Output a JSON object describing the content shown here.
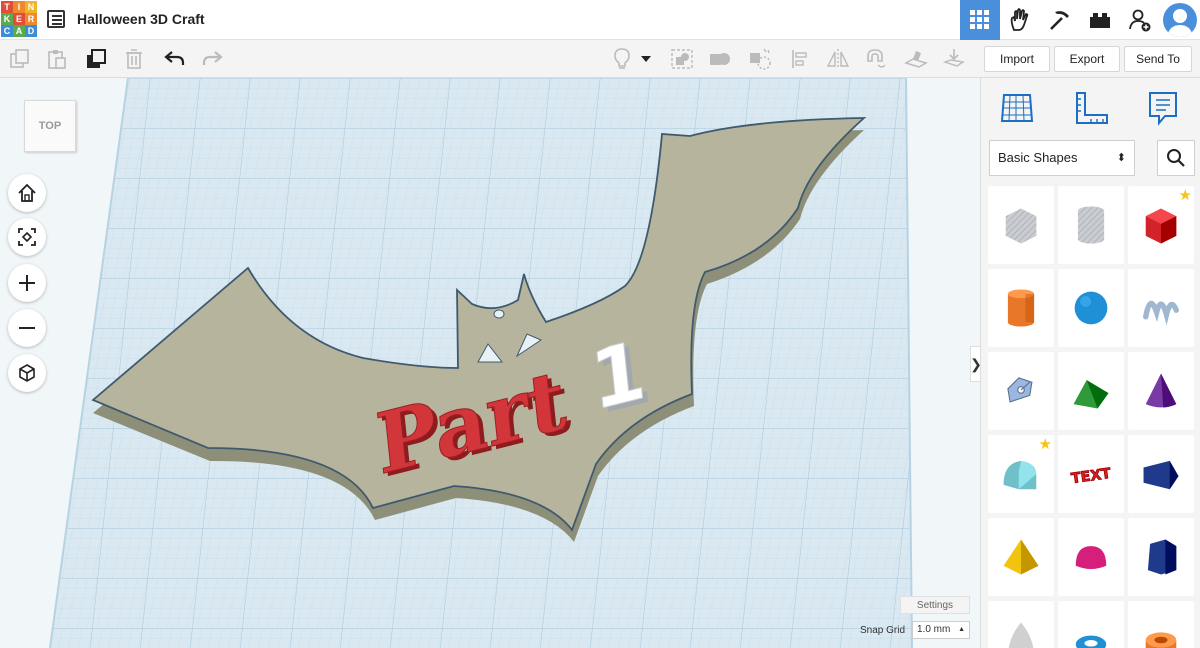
{
  "app": {
    "logo_letters": [
      "T",
      "I",
      "N",
      "K",
      "E",
      "R",
      "C",
      "A",
      "D"
    ],
    "logo_colors": [
      "#e04d39",
      "#ef8a2c",
      "#f0b429",
      "#5cab4b",
      "#e04d39",
      "#ef8a2c",
      "#3b8dd6",
      "#5cab4b",
      "#3b8dd6"
    ],
    "document_title": "Halloween 3D Craft",
    "accent_color": "#4a8fdb"
  },
  "topbar": {
    "buttons": [
      {
        "name": "3d-design-view",
        "icon": "grid-icon",
        "active": true
      },
      {
        "name": "blocks-view",
        "icon": "hand-icon",
        "active": false
      },
      {
        "name": "lessons-view",
        "icon": "pickaxe-icon",
        "active": false
      },
      {
        "name": "bricks-view",
        "icon": "brick-icon",
        "active": false
      },
      {
        "name": "add-user",
        "icon": "add-user-icon",
        "active": false
      }
    ]
  },
  "toolbar": {
    "import_label": "Import",
    "export_label": "Export",
    "send_to_label": "Send To"
  },
  "workplane": {
    "view_cube_label": "TOP",
    "design_text": "Part",
    "design_number": "1",
    "settings_label": "Settings",
    "snap_grid_label": "Snap Grid",
    "snap_grid_value": "1.0 mm",
    "collapse_glyph": "❯"
  },
  "panel": {
    "category_label": "Basic Shapes",
    "shapes": [
      {
        "name": "box-hole",
        "color": "#bfc3c9",
        "starred": false
      },
      {
        "name": "cylinder-hole",
        "color": "#bfc3c9",
        "starred": false
      },
      {
        "name": "box",
        "color": "#d2232a",
        "starred": true
      },
      {
        "name": "cylinder",
        "color": "#e8772a",
        "starred": false
      },
      {
        "name": "sphere",
        "color": "#1f8fd6",
        "starred": false
      },
      {
        "name": "scribble",
        "color": "#9fb8d0",
        "starred": false
      },
      {
        "name": "shape-generator",
        "color": "#9bb7e0",
        "starred": false
      },
      {
        "name": "roof",
        "color": "#2f9a3a",
        "starred": false
      },
      {
        "name": "cone",
        "color": "#7a3aa6",
        "starred": false
      },
      {
        "name": "round-roof",
        "color": "#6fc0c8",
        "starred": true
      },
      {
        "name": "text",
        "color": "#d2232a",
        "starred": false
      },
      {
        "name": "wedge-prism",
        "color": "#1f3a8a",
        "starred": false
      },
      {
        "name": "pyramid",
        "color": "#f1c40f",
        "starred": false
      },
      {
        "name": "half-sphere",
        "color": "#d61f7a",
        "starred": false
      },
      {
        "name": "polygon",
        "color": "#1f3a8a",
        "starred": false
      },
      {
        "name": "paraboloid",
        "color": "#d0d0d0",
        "starred": false
      },
      {
        "name": "torus",
        "color": "#1f8fd6",
        "starred": false
      },
      {
        "name": "tube",
        "color": "#e8772a",
        "starred": false
      }
    ],
    "text_shape_label": "TEXT"
  }
}
